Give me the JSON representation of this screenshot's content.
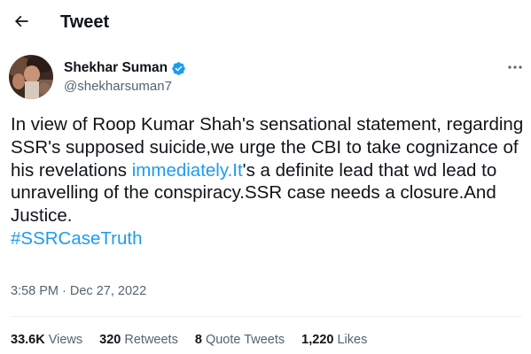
{
  "header": {
    "title": "Tweet"
  },
  "author": {
    "name": "Shekhar Suman",
    "handle": "@shekharsuman7"
  },
  "tweet": {
    "text_before": "In view of Roop Kumar Shah's sensational statement, regarding SSR's supposed suicide,we urge the CBI to take cognizance of his revelations ",
    "link_text": "immediately.It",
    "text_after": "'s a definite lead that wd lead to unravelling of the conspiracy.SSR case needs a closure.And Justice.",
    "hashtag": "#SSRCaseTruth"
  },
  "timestamp": "3:58 PM · Dec 27, 2022",
  "stats": {
    "views_count": "33.6K",
    "views_label": "Views",
    "retweets_count": "320",
    "retweets_label": "Retweets",
    "quotes_count": "8",
    "quotes_label": "Quote Tweets",
    "likes_count": "1,220",
    "likes_label": "Likes"
  },
  "colors": {
    "link": "#1d9bf0",
    "secondary_text": "#536471",
    "primary_text": "#0f1419",
    "divider": "#eff3f4"
  },
  "icons": {
    "back": "arrow-left-icon",
    "verified": "verified-badge-icon",
    "more": "more-horizontal-icon"
  }
}
